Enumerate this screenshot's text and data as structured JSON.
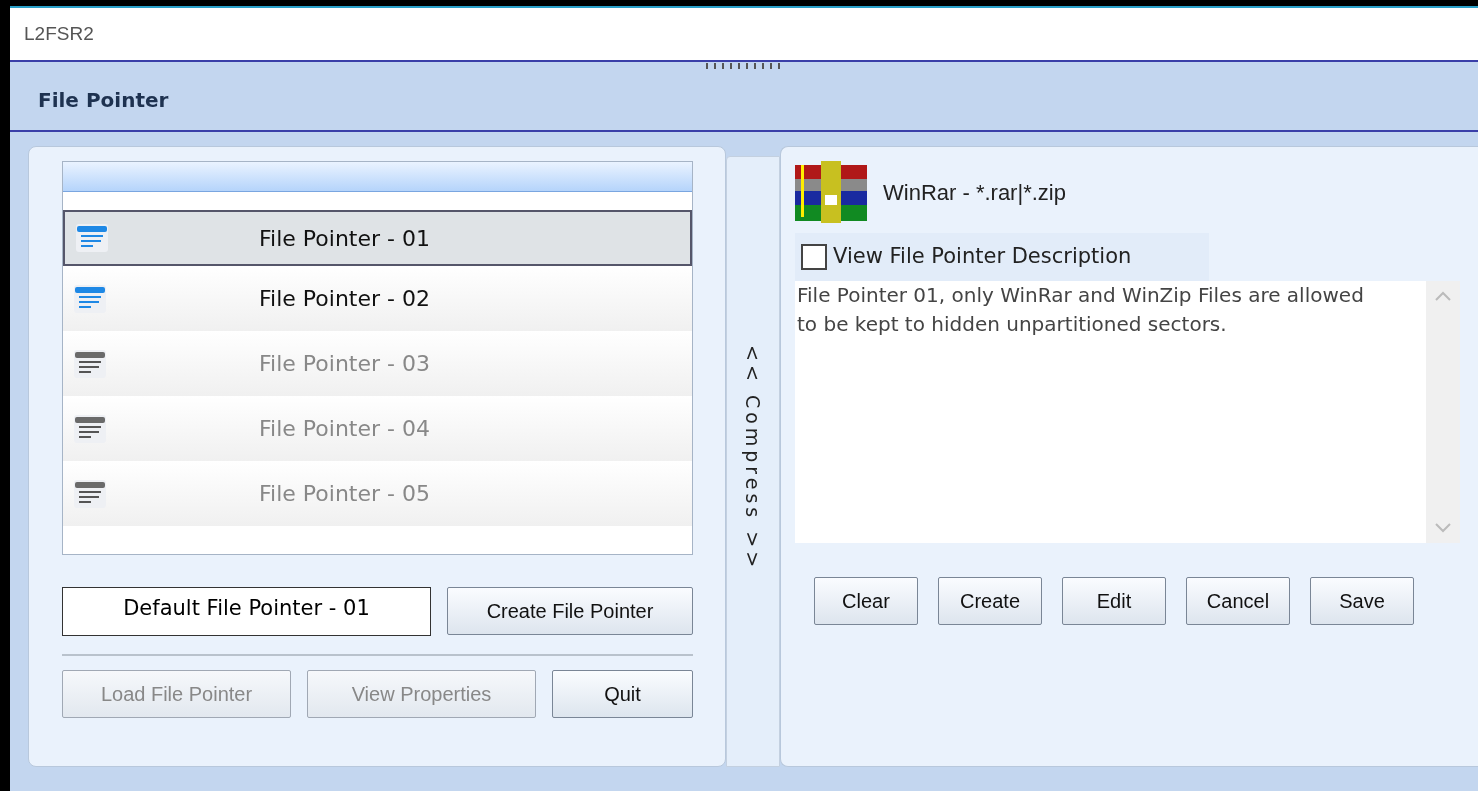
{
  "window": {
    "title": "L2FSR2"
  },
  "header": {
    "title": "File Pointer"
  },
  "file_list": {
    "items": [
      {
        "label": "File Pointer - 01",
        "selected": true,
        "enabled": true
      },
      {
        "label": "File Pointer - 02",
        "selected": false,
        "enabled": true
      },
      {
        "label": "File Pointer - 03",
        "selected": false,
        "enabled": false
      },
      {
        "label": "File Pointer - 04",
        "selected": false,
        "enabled": false
      },
      {
        "label": "File Pointer - 05",
        "selected": false,
        "enabled": false
      }
    ]
  },
  "name_field": {
    "value": "Default File Pointer - 01"
  },
  "create_button": {
    "label": "Create File Pointer",
    "disabled": false
  },
  "bottom_buttons": [
    {
      "label": "Load File Pointer",
      "disabled": true
    },
    {
      "label": "View Properties",
      "disabled": true
    },
    {
      "label": "Quit",
      "disabled": false
    }
  ],
  "splitter": {
    "label": "<< Compress >>"
  },
  "details": {
    "type_label": "WinRar - *.rar|*.zip",
    "description_toggle": {
      "label": "View File Pointer Description",
      "checked": false
    },
    "description": "File Pointer 01, only WinRar and WinZip Files are allowed to be kept to hidden unpartitioned sectors.",
    "buttons": [
      {
        "label": "Clear",
        "disabled": false
      },
      {
        "label": "Create",
        "disabled": false
      },
      {
        "label": "Edit",
        "disabled": false
      },
      {
        "label": "Cancel",
        "disabled": false
      },
      {
        "label": "Save",
        "disabled": false
      }
    ]
  }
}
